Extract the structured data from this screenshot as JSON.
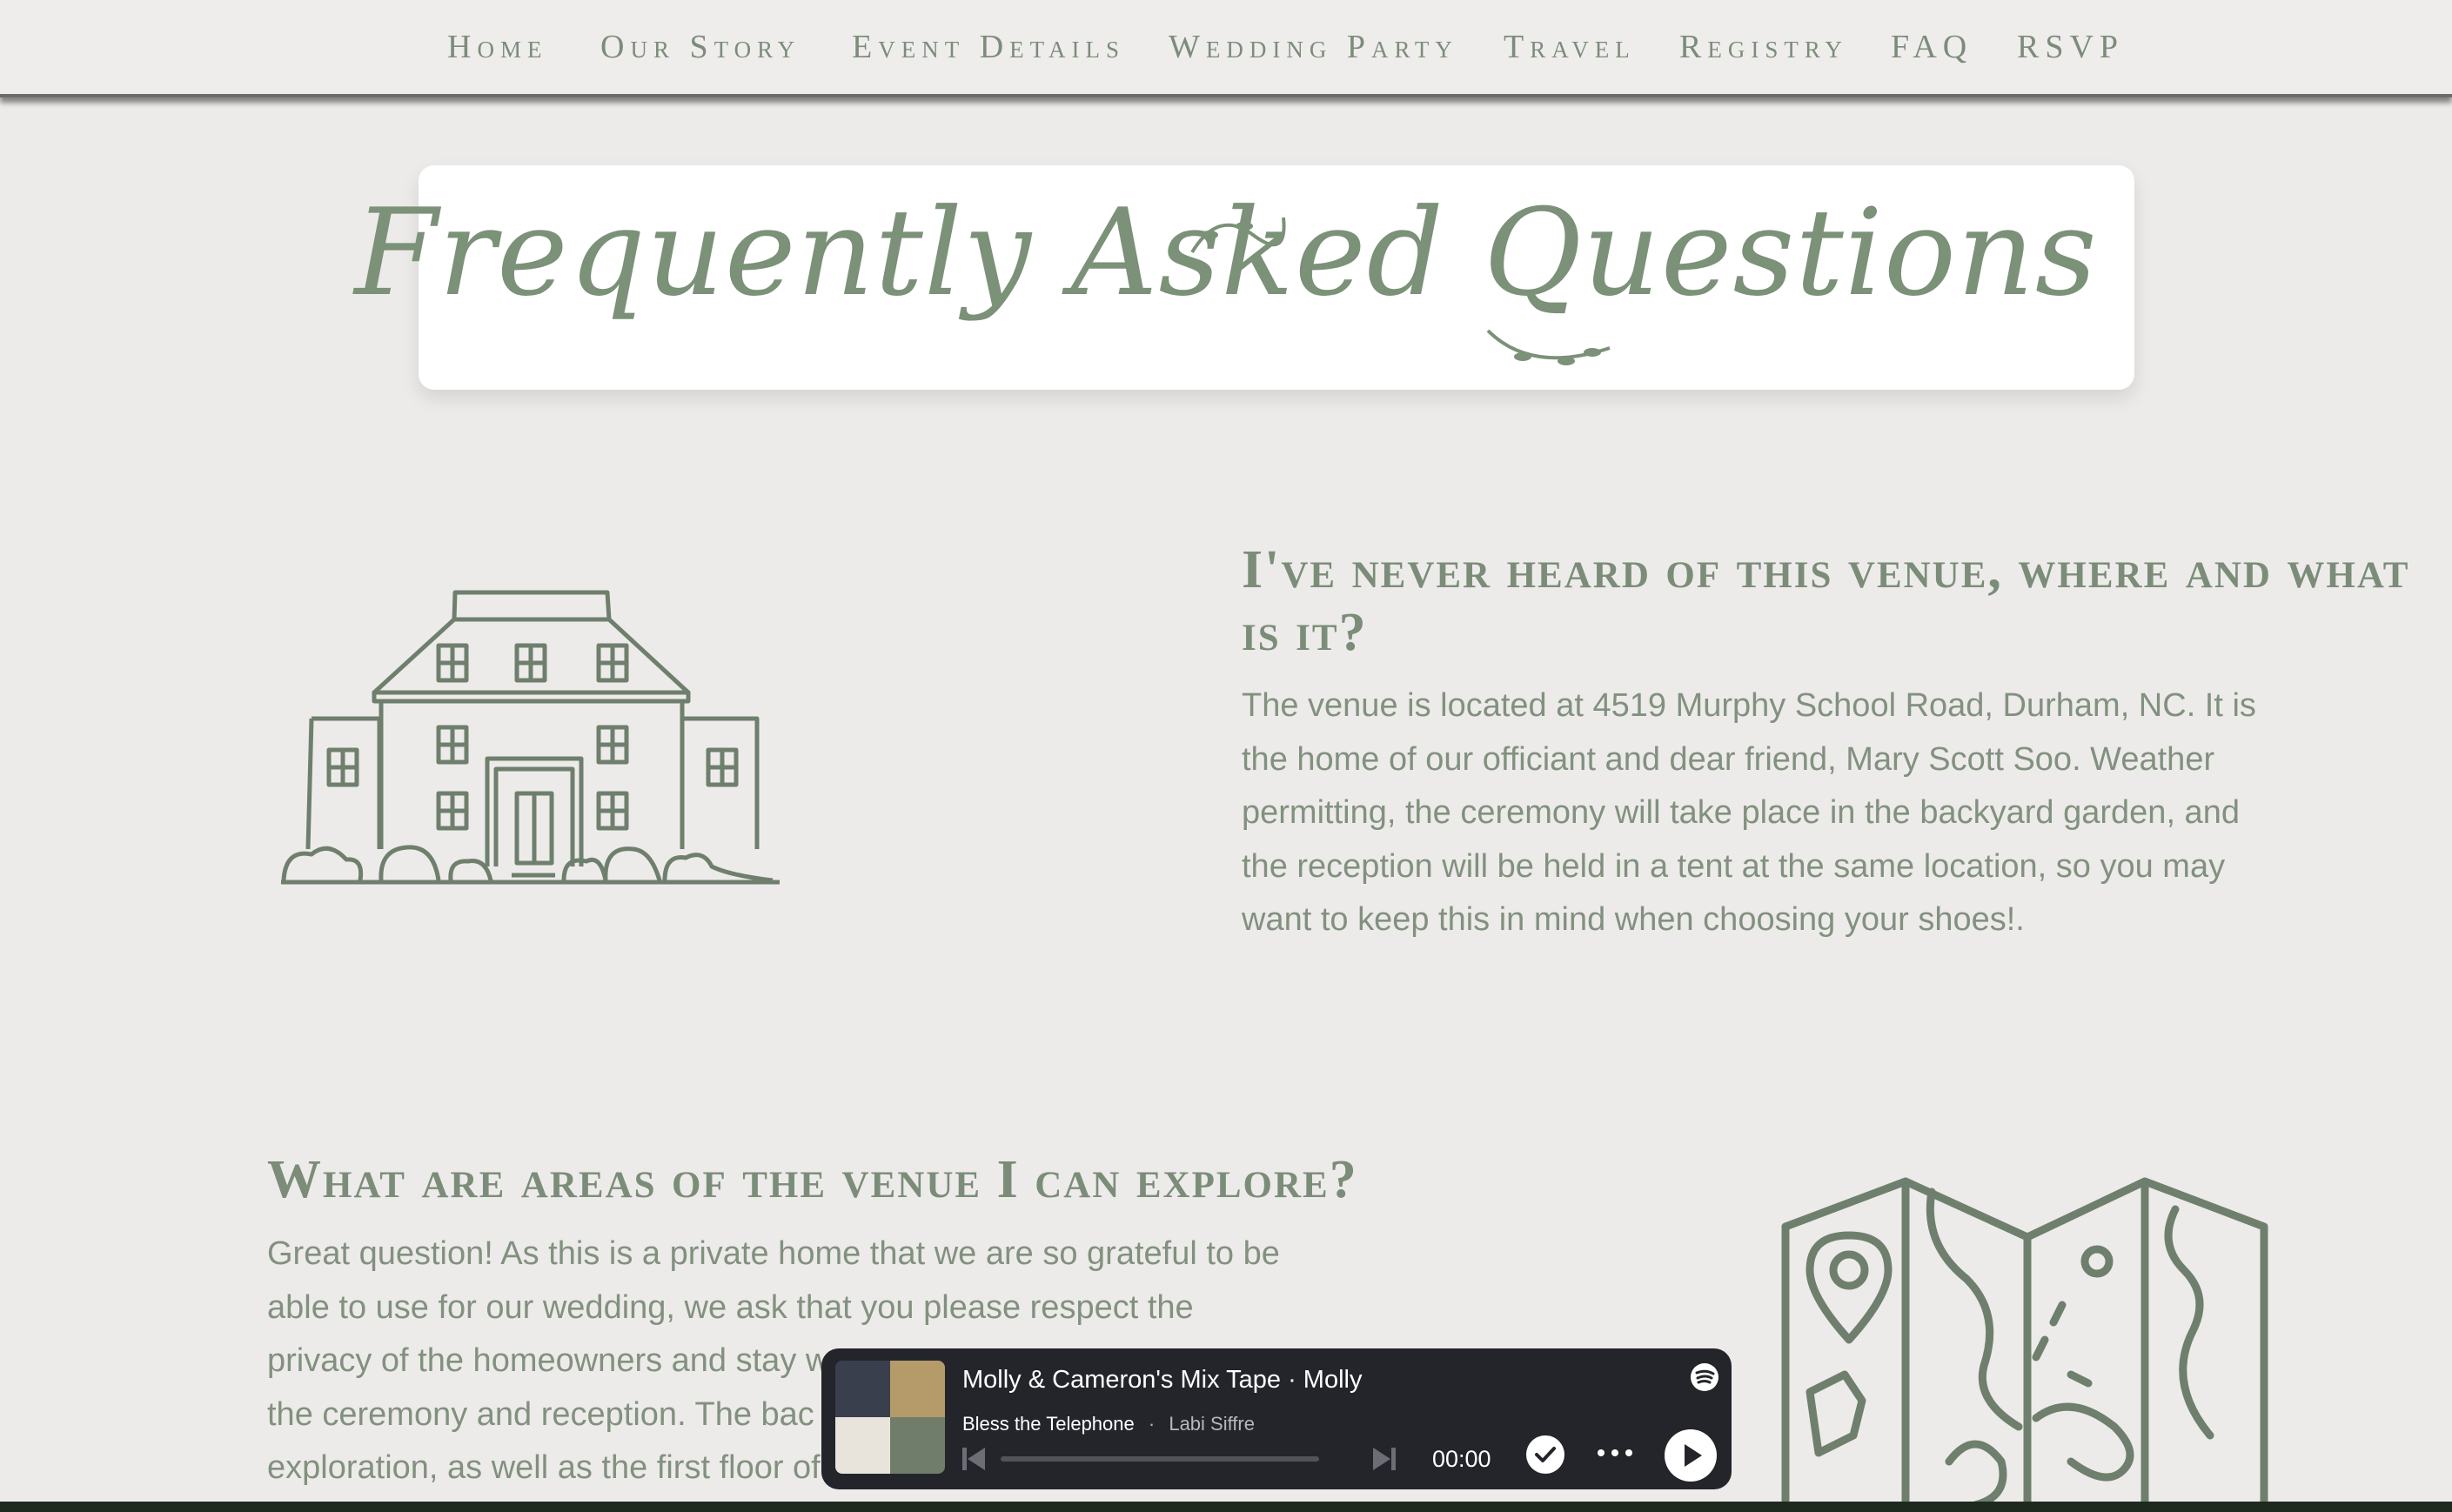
{
  "nav": {
    "items": [
      "Home",
      "Our Story",
      "Event Details",
      "Wedding Party",
      "Travel",
      "Registry",
      "FAQ",
      "RSVP"
    ]
  },
  "page": {
    "title": "Frequently Asked Questions"
  },
  "faq": [
    {
      "question_line1": "I've never heard of this venue, where and what",
      "question_line2": "is it?",
      "answer_lines": [
        "The venue is located at 4519 Murphy School Road, Durham, NC. It is",
        "the home of our officiant and dear friend, Mary Scott Soo. Weather",
        "permitting, the ceremony will take place in the backyard garden, and",
        "the reception will be held in a tent at the same location, so you may",
        "want to keep this in mind when choosing your shoes!."
      ],
      "icon": "house-illustration"
    },
    {
      "question_line1": "What are areas of the venue I can explore?",
      "answer_lines": [
        "Great question! As this is a private home that we are so grateful to be",
        "able to use for our wedding, we ask that you please respect the",
        "privacy of the homeowners and stay w",
        "the ceremony and reception. The bac",
        "exploration, as well as the first floor of"
      ],
      "icon": "map-illustration"
    }
  ],
  "player": {
    "title": "Molly & Cameron's Mix Tape · Molly",
    "track": "Bless the Telephone",
    "separator": "·",
    "artist": "Labi Siffre",
    "time": "00:00",
    "progress": 0,
    "icons": [
      "spotify-icon",
      "previous-icon",
      "next-icon",
      "saved-check-icon",
      "more-icon",
      "play-icon"
    ]
  },
  "colors": {
    "background": "#edebe9",
    "accent_green": "#7b8d79",
    "player_bg": "#23252b"
  }
}
